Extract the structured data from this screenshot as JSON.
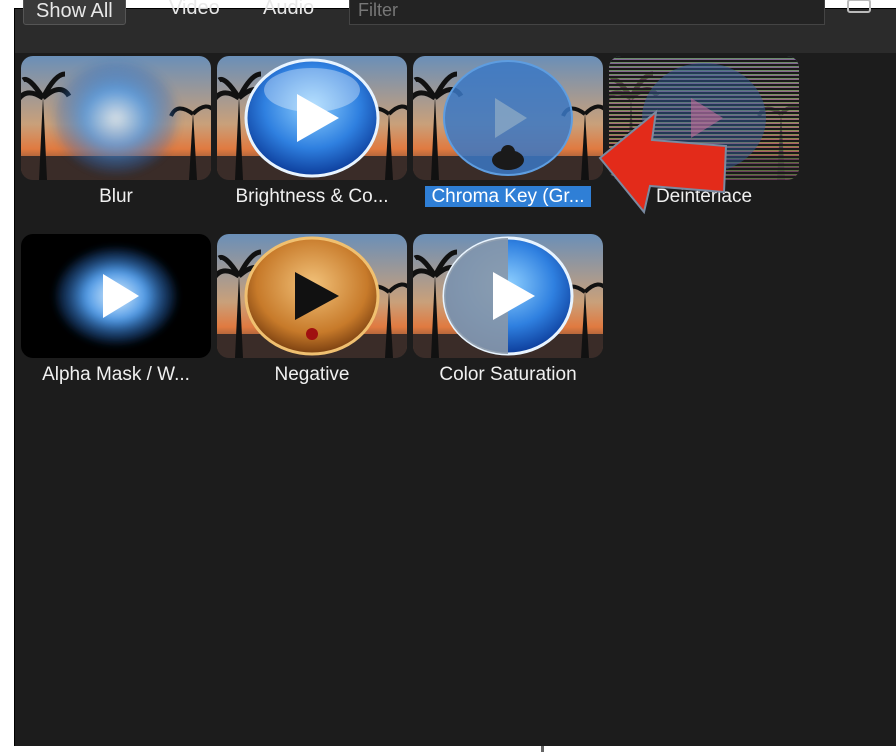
{
  "toolbar": {
    "show_all": "Show All",
    "video": "Video",
    "audio": "Audio",
    "filter_placeholder": "Filter",
    "icon": "clear-filter-icon"
  },
  "effects": [
    {
      "label": "Blur",
      "selected": false,
      "icon": "blur-play-icon"
    },
    {
      "label": "Brightness & Co...",
      "selected": false,
      "icon": "play-icon"
    },
    {
      "label": "Chroma Key (Gr...",
      "selected": true,
      "icon": "chroma-key-icon"
    },
    {
      "label": "Deinterlace",
      "selected": false,
      "icon": "deinterlace-icon"
    },
    {
      "label": "Alpha Mask / W...",
      "selected": false,
      "icon": "alpha-mask-icon"
    },
    {
      "label": "Negative",
      "selected": false,
      "icon": "negative-icon"
    },
    {
      "label": "Color Saturation",
      "selected": false,
      "icon": "saturation-icon"
    }
  ],
  "annotation": {
    "icon": "red-arrow-icon",
    "color": "#e32b1a"
  },
  "colors": {
    "panel_bg": "#1c1c1c",
    "selection": "#2f7fd6"
  }
}
